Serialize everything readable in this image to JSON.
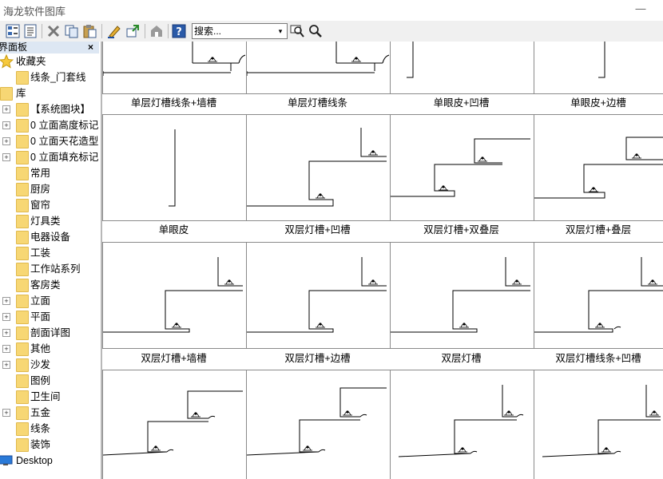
{
  "window": {
    "title": "海龙软件图库",
    "minimize": "—"
  },
  "toolbar": {
    "search_placeholder": "搜索...",
    "dropdown_glyph": "▾"
  },
  "sidebar": {
    "panel_title": "界面板",
    "close_glyph": "×",
    "items": [
      {
        "label": "收藏夹"
      },
      {
        "label": "线条_门套线"
      },
      {
        "label": "库"
      },
      {
        "label": "【系统图块】"
      },
      {
        "label": "0 立面高度标记"
      },
      {
        "label": "0 立面天花造型"
      },
      {
        "label": "0 立面填充标记"
      },
      {
        "label": "常用"
      },
      {
        "label": "厨房"
      },
      {
        "label": "窗帘"
      },
      {
        "label": "灯具类"
      },
      {
        "label": "电器设备"
      },
      {
        "label": "工装"
      },
      {
        "label": "工作站系列"
      },
      {
        "label": "客房类"
      },
      {
        "label": "立面"
      },
      {
        "label": "平面"
      },
      {
        "label": "剖面详图"
      },
      {
        "label": "其他"
      },
      {
        "label": "沙发"
      },
      {
        "label": "图例"
      },
      {
        "label": "卫生间"
      },
      {
        "label": "五金"
      },
      {
        "label": "线条"
      },
      {
        "label": "装饰"
      },
      {
        "label": "Desktop"
      }
    ]
  },
  "gallery": {
    "captions": [
      [
        "单层灯槽线条+墙槽",
        "单层灯槽线条",
        "单眼皮+凹槽",
        "单眼皮+边槽"
      ],
      [
        "单眼皮",
        "双层灯槽+凹槽",
        "双层灯槽+双叠层",
        "双层灯槽+叠层"
      ],
      [
        "双层灯槽+墙槽",
        "双层灯槽+边槽",
        "双层灯槽",
        "双层灯槽线条+凹槽"
      ]
    ]
  }
}
